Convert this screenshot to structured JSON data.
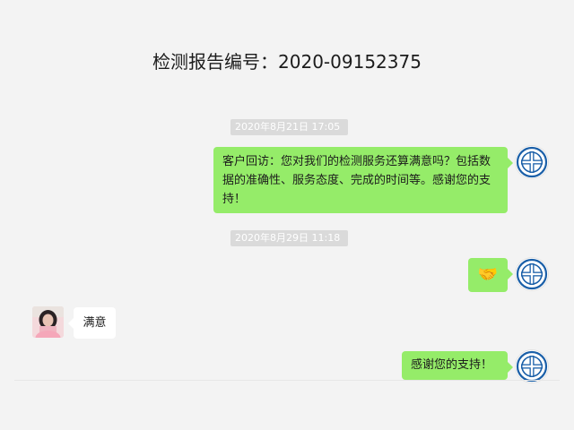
{
  "header": {
    "title": "检测报告编号：2020-09152375"
  },
  "chat": {
    "timestamps": [
      "2020年8月21日 17:05",
      "2020年8月29日 11:18"
    ],
    "messages": [
      {
        "sender": "org",
        "text": "客户回访：您对我们的检测服务还算满意吗？包括数据的准确性、服务态度、完成的时间等。感谢您的支持！"
      },
      {
        "sender": "org",
        "text": "🤝"
      },
      {
        "sender": "customer",
        "text": "满意"
      },
      {
        "sender": "org",
        "text": "感谢您的支持！"
      }
    ]
  },
  "colors": {
    "background": "#f3f3f3",
    "outgoing_bubble": "#95ec69",
    "incoming_bubble": "#ffffff",
    "timestamp_bg": "#dadada",
    "logo_blue": "#1a5fa8"
  },
  "icons": {
    "org_avatar": "org-logo-icon",
    "user_avatar": "user-photo-avatar"
  }
}
